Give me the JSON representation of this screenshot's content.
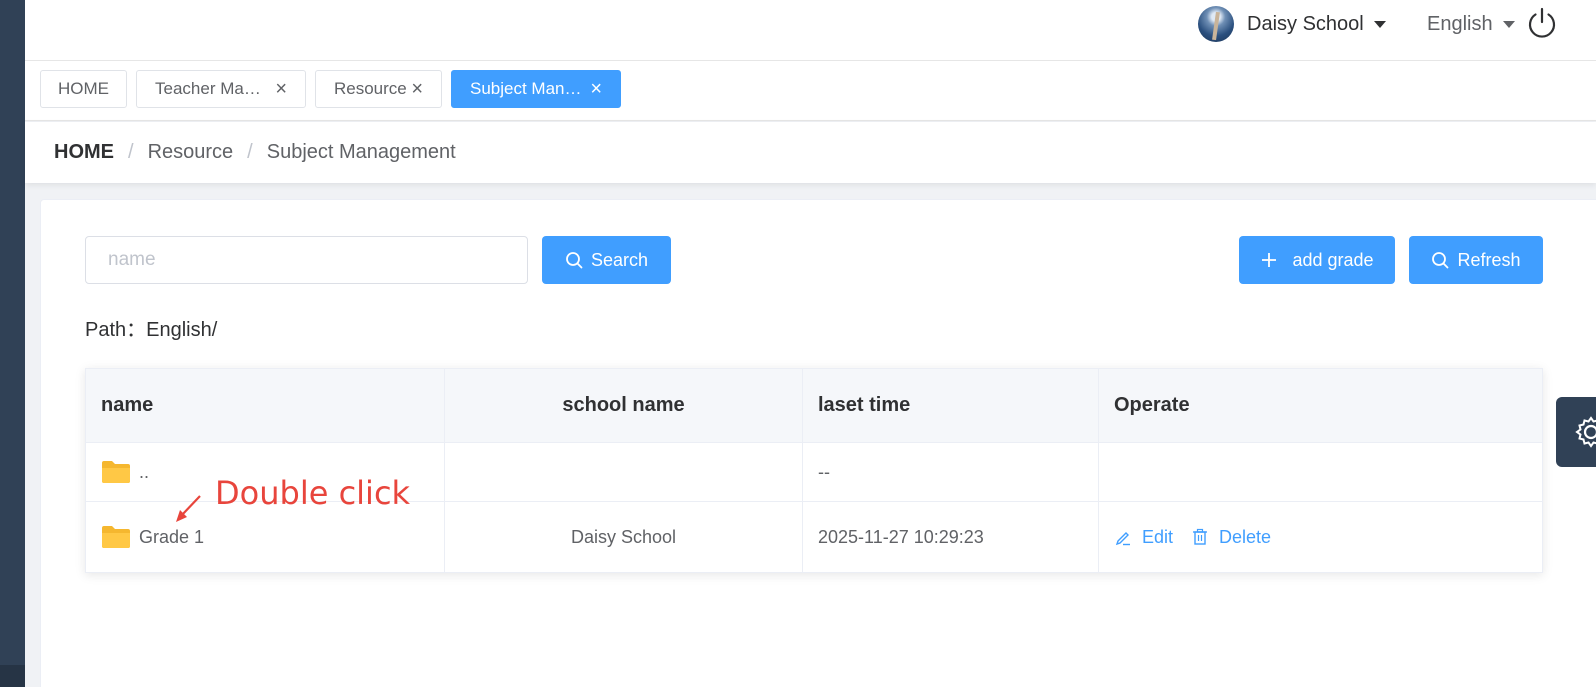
{
  "header": {
    "user_name": "Daisy School",
    "language": "English"
  },
  "tabs": [
    {
      "label": "HOME"
    },
    {
      "label": "Teacher Ma…"
    },
    {
      "label": "Resource"
    },
    {
      "label": "Subject Man…"
    }
  ],
  "breadcrumb": [
    "HOME",
    "Resource",
    "Subject Management"
  ],
  "search": {
    "placeholder": "name",
    "value": "",
    "search_label": "Search"
  },
  "actions": {
    "add_label": "add grade",
    "refresh_label": "Refresh"
  },
  "path": {
    "label": "Path：",
    "value": "English/"
  },
  "table": {
    "columns": [
      "name",
      "school name",
      "laset time",
      "Operate"
    ],
    "rows": [
      {
        "name": "..",
        "school": "",
        "time": "--",
        "operations": []
      },
      {
        "name": "Grade 1",
        "school": "Daisy School",
        "time": "2025-11-27 10:29:23",
        "operations": [
          "Edit",
          "Delete"
        ]
      }
    ]
  },
  "annotation": "Double click",
  "colors": {
    "primary": "#409eff",
    "sidebar": "#304156",
    "annotation": "#e8453c",
    "folder": "#f5b72f"
  }
}
